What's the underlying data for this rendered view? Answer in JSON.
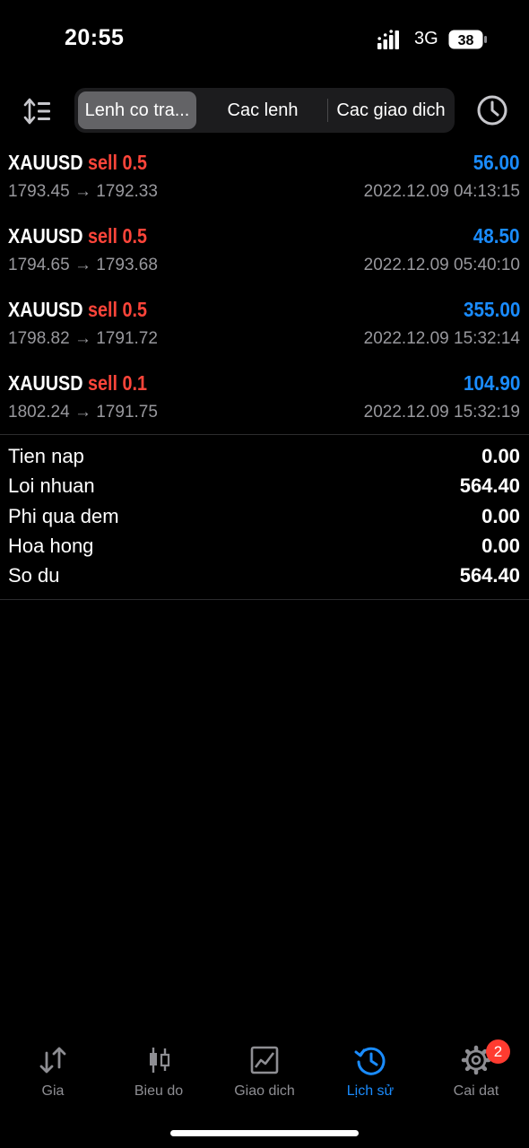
{
  "status": {
    "time": "20:55",
    "network": "3G",
    "battery": "38"
  },
  "tabs": [
    {
      "label": "Lenh co tra...",
      "active": true
    },
    {
      "label": "Cac lenh",
      "active": false
    },
    {
      "label": "Cac giao dich",
      "active": false
    }
  ],
  "deals": [
    {
      "symbol": "XAUUSD",
      "side": "sell",
      "volume": "0.5",
      "profit": "56.00",
      "prices": "1793.45 → 1792.33",
      "datetime": "2022.12.09 04:13:15"
    },
    {
      "symbol": "XAUUSD",
      "side": "sell",
      "volume": "0.5",
      "profit": "48.50",
      "prices": "1794.65 → 1793.68",
      "datetime": "2022.12.09 05:40:10"
    },
    {
      "symbol": "XAUUSD",
      "side": "sell",
      "volume": "0.5",
      "profit": "355.00",
      "prices": "1798.82 → 1791.72",
      "datetime": "2022.12.09 15:32:14"
    },
    {
      "symbol": "XAUUSD",
      "side": "sell",
      "volume": "0.1",
      "profit": "104.90",
      "prices": "1802.24 → 1791.75",
      "datetime": "2022.12.09 15:32:19"
    }
  ],
  "summary": [
    {
      "label": "Tien nap",
      "value": "0.00"
    },
    {
      "label": "Loi nhuan",
      "value": "564.40"
    },
    {
      "label": "Phi qua dem",
      "value": "0.00"
    },
    {
      "label": "Hoa hong",
      "value": "0.00"
    },
    {
      "label": "So du",
      "value": "564.40"
    }
  ],
  "nav": [
    {
      "label": "Gia",
      "icon": "quotes-arrows-icon",
      "active": false
    },
    {
      "label": "Bieu do",
      "icon": "candlestick-icon",
      "active": false
    },
    {
      "label": "Giao dich",
      "icon": "trade-chart-icon",
      "active": false
    },
    {
      "label": "Lịch sử",
      "icon": "history-clock-icon",
      "active": true
    },
    {
      "label": "Cai dat",
      "icon": "settings-gear-icon",
      "active": false
    }
  ],
  "settings_badge": "2",
  "colors": {
    "profit": "#1a8cff",
    "sell": "#ff453a",
    "active_tab": "#1a8cff",
    "badge": "#ff3b30"
  }
}
